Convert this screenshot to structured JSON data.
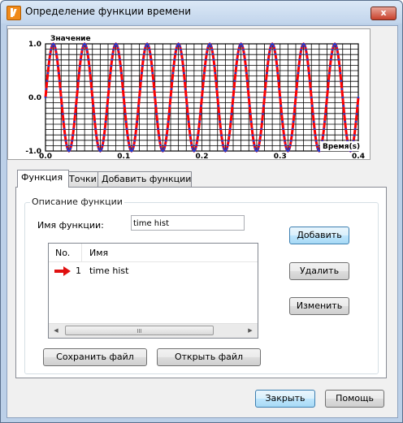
{
  "window": {
    "title": "Определение функции времени",
    "close_glyph": "x"
  },
  "chart": {
    "ylabel": "Значение",
    "xlabel": "Время(s)",
    "yticks": [
      "1.0",
      "0.0",
      "-1.0"
    ],
    "xticks": [
      "0.0",
      "0.1",
      "0.2",
      "0.3",
      "0.4"
    ]
  },
  "chart_data": {
    "type": "line",
    "title": "",
    "xlabel": "Время(s)",
    "ylabel": "Значение",
    "xlim": [
      0,
      0.4
    ],
    "ylim": [
      -1.0,
      1.0
    ],
    "grid": true,
    "frequency_hz": 25,
    "sample_step": 0.001,
    "function": "sin(2*pi*25*t)",
    "series": [
      {
        "color_line": "#ff0000",
        "color_points": "#1f3fd0"
      }
    ]
  },
  "tabs": [
    "Функция",
    "Точки",
    "Добавить функции"
  ],
  "active_tab": 0,
  "group": {
    "title": "Описание функции"
  },
  "form": {
    "name_label": "Имя функции:",
    "name_value": "time hist"
  },
  "table": {
    "columns": [
      "No.",
      "Имя"
    ],
    "rows": [
      {
        "no": "1",
        "name": "time hist"
      }
    ],
    "scroll_thumb_glyph": "III",
    "scroll_left_glyph": "◀",
    "scroll_right_glyph": "▶"
  },
  "buttons": {
    "add": "Добавить",
    "delete": "Удалить",
    "modify": "Изменить",
    "save_file": "Сохранить файл",
    "open_file": "Открыть файл",
    "close": "Закрыть",
    "help": "Помощь"
  },
  "colors": {
    "accent": "#ff0000",
    "points": "#1f3fd0",
    "arrow": "#e01010"
  }
}
